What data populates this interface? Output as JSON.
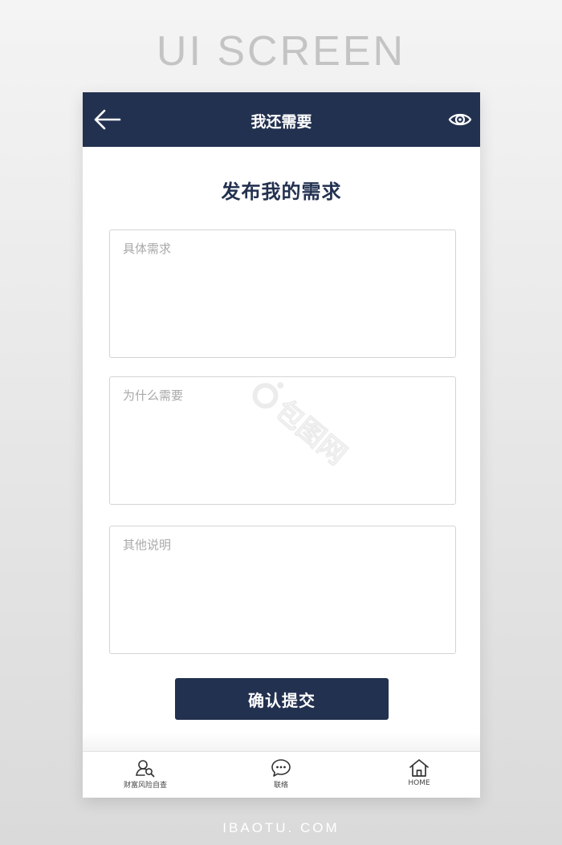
{
  "showcase": {
    "title": "UI SCREEN",
    "footer": "IBAOTU. COM"
  },
  "nav": {
    "title": "我还需要",
    "back_icon": "arrow-left-icon",
    "right_icon": "eye-icon"
  },
  "page": {
    "title": "发布我的需求"
  },
  "form": {
    "fields": [
      {
        "placeholder": "具体需求",
        "value": ""
      },
      {
        "placeholder": "为什么需要",
        "value": ""
      },
      {
        "placeholder": "其他说明",
        "value": ""
      }
    ],
    "submit_label": "确认提交"
  },
  "tabbar": {
    "items": [
      {
        "label": "财富风险自查",
        "icon": "person-search-icon"
      },
      {
        "label": "联络",
        "icon": "chat-bubble-icon"
      },
      {
        "label": "HOME",
        "icon": "home-icon"
      }
    ]
  },
  "watermark": {
    "text": "包图网"
  },
  "colors": {
    "primary": "#233150",
    "background": "#ffffff",
    "border": "#d4d4d4"
  }
}
